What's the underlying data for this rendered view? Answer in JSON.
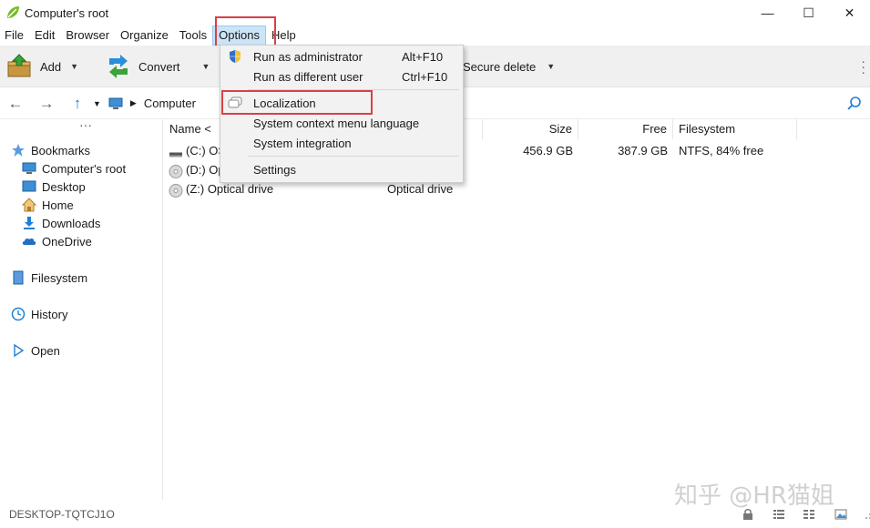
{
  "window": {
    "title": "Computer's root",
    "minimize": "—",
    "maximize": "☐",
    "close": "✕"
  },
  "menubar": {
    "file": "File",
    "edit": "Edit",
    "browser": "Browser",
    "organize": "Organize",
    "tools": "Tools",
    "options": "Options",
    "help": "Help"
  },
  "toolbar": {
    "add": "Add",
    "convert": "Convert",
    "secure_delete": "Secure delete"
  },
  "address": {
    "crumb": "Computer"
  },
  "sidebar": {
    "bookmarks": "Bookmarks",
    "items": [
      "Computer's root",
      "Desktop",
      "Home",
      "Downloads",
      "OneDrive"
    ],
    "filesystem": "Filesystem",
    "history": "History",
    "open": "Open"
  },
  "filelist": {
    "columns": {
      "name": "Name <",
      "size": "Size",
      "free": "Free",
      "filesystem": "Filesystem"
    },
    "rows": [
      {
        "name": "(C:) OS",
        "type": "",
        "size": "456.9 GB",
        "free": "387.9 GB",
        "filesystem": "NTFS, 84% free"
      },
      {
        "name": "(D:) Op",
        "type": "",
        "size": "",
        "free": "",
        "filesystem": ""
      },
      {
        "name": "(Z:) Optical drive",
        "type": "Optical drive",
        "size": "",
        "free": "",
        "filesystem": ""
      }
    ]
  },
  "options_menu": {
    "run_admin": "Run as administrator",
    "run_admin_shortcut": "Alt+F10",
    "run_other": "Run as different user",
    "run_other_shortcut": "Ctrl+F10",
    "localization": "Localization",
    "context_lang": "System context menu language",
    "integration": "System integration",
    "settings": "Settings"
  },
  "status": {
    "computer_name": "DESKTOP-TQTCJ1O"
  },
  "watermark": "知乎 @HR猫姐",
  "colors": {
    "highlight_box": "#d94046",
    "active_menu": "#cce4f7",
    "accent": "#1f7fd6"
  }
}
